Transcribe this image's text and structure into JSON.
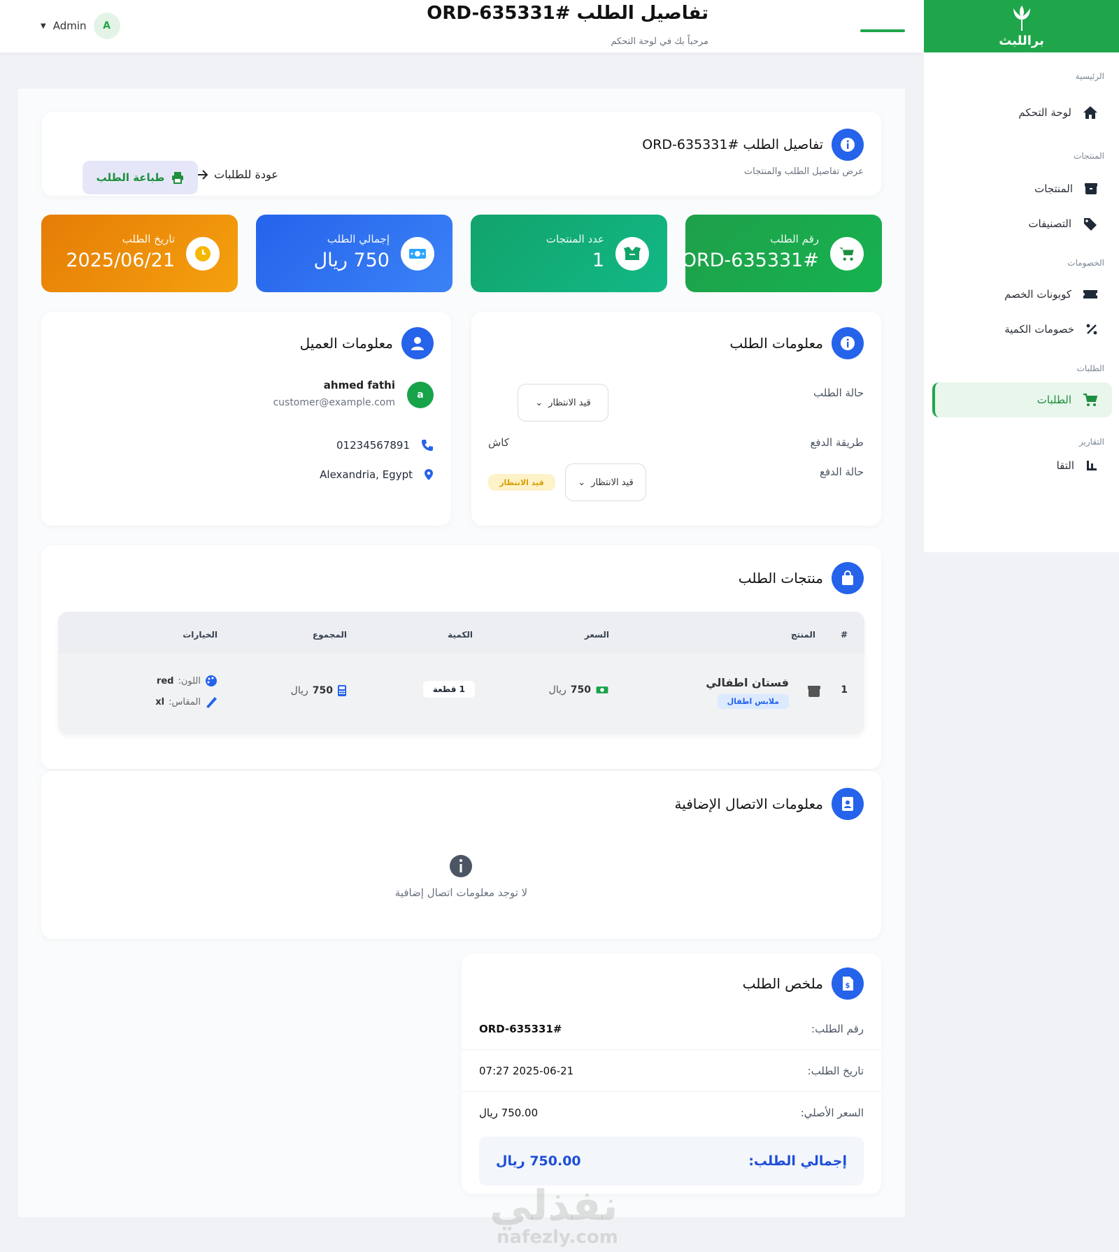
{
  "brand": {
    "name": "براللبث",
    "color": "#20a64a"
  },
  "header": {
    "title": "تفاصيل الطلب #ORD-635331",
    "subtitle": "مرحباً بك في لوحة التحكم",
    "user_name": "Admin",
    "user_initial": "A"
  },
  "sidebar": {
    "sections": [
      {
        "title": "الرئيسية",
        "items": [
          {
            "label": "لوحة التحكم",
            "icon": "home-icon"
          }
        ]
      },
      {
        "title": "المنتجات",
        "items": [
          {
            "label": "المنتجات",
            "icon": "box-icon"
          },
          {
            "label": "التصنيفات",
            "icon": "tags-icon"
          }
        ]
      },
      {
        "title": "الخصومات",
        "items": [
          {
            "label": "كوبونات الخصم",
            "icon": "ticket-icon"
          },
          {
            "label": "خصومات الكمية",
            "icon": "percent-icon"
          }
        ]
      },
      {
        "title": "الطلبات",
        "items": [
          {
            "label": "الطلبات",
            "icon": "cart-icon",
            "active": true
          }
        ]
      },
      {
        "title": "التقارير",
        "items": [
          {
            "label": "التقا",
            "icon": "chart-icon"
          }
        ]
      }
    ]
  },
  "details_header": {
    "title": "تفاصيل الطلب #ORD-635331",
    "subtitle": "عرض تفاصيل الطلب والمنتجات",
    "back_label": "عودة للطلبات",
    "print_label": "طباعة الطلب"
  },
  "stats": [
    {
      "label": "رقم الطلب",
      "value": "#ORD-635331",
      "icon": "cart-icon",
      "color": "#16a34a"
    },
    {
      "label": "عدد المنتجات",
      "value": "1",
      "icon": "open-box-icon",
      "color": "#10b27a"
    },
    {
      "label": "إجمالي الطلب",
      "value": "750 ريال",
      "icon": "money-icon",
      "color": "#2f6df0"
    },
    {
      "label": "تاريخ الطلب",
      "value": "2025/06/21",
      "icon": "clock-icon",
      "color": "#f08a0b"
    }
  ],
  "order_info": {
    "title": "معلومات الطلب",
    "status_label": "حالة الطلب",
    "status_value": "قيد الانتظار",
    "payment_method_label": "طريقة الدفع",
    "payment_method_value": "كاش",
    "payment_status_label": "حالة الدفع",
    "payment_status_value": "قيد الانتظار",
    "payment_status_badge": "قيد الانتظار"
  },
  "customer": {
    "title": "معلومات العميل",
    "initial": "a",
    "name": "ahmed fathi",
    "email": "customer@example.com",
    "phone": "01234567891",
    "address": "Alexandria, Egypt"
  },
  "products": {
    "title": "منتجات الطلب",
    "columns": [
      "#",
      "المنتج",
      "السعر",
      "الكمية",
      "المجموع",
      "الخيارات"
    ],
    "rows": [
      {
        "index": "1",
        "name": "فستان اطفالي",
        "category": "ملابس اطفال",
        "price_amount": "750",
        "price_currency": "ريال",
        "quantity": "1 قطعة",
        "total_amount": "750",
        "total_currency": "ريال",
        "color_label": "اللون:",
        "color_value": "red",
        "size_label": "المقاس:",
        "size_value": "xl"
      }
    ]
  },
  "contact": {
    "title": "معلومات الاتصال الإضافية",
    "empty_message": "لا توجد معلومات اتصال إضافية"
  },
  "summary": {
    "title": "ملخص الطلب",
    "rows": [
      {
        "label": "رقم الطلب:",
        "value": "#ORD-635331"
      },
      {
        "label": "تاريخ الطلب:",
        "value": "2025-06-21 07:27"
      },
      {
        "label": "السعر الأصلي:",
        "value": "750.00 ريال"
      }
    ],
    "total_label": "إجمالي الطلب:",
    "total_value": "750.00 ريال"
  },
  "watermark": {
    "text": "نفذلي",
    "url": "nafezly.com"
  }
}
